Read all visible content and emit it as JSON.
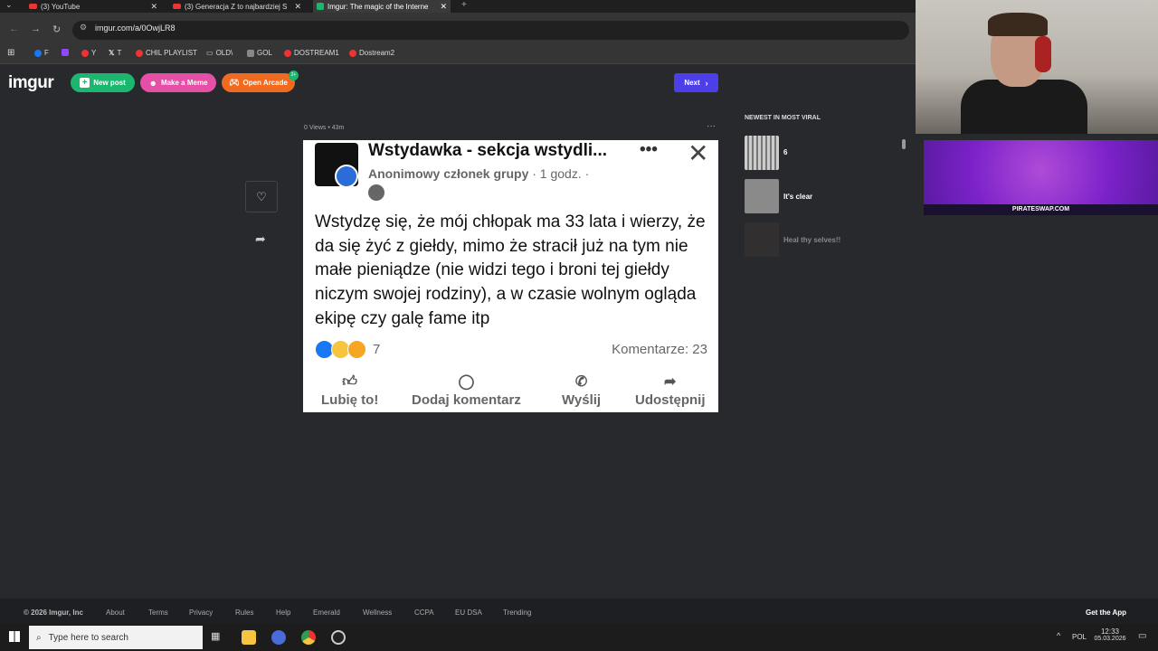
{
  "browser": {
    "tabs": [
      {
        "title": "(3) YouTube",
        "close": "✕"
      },
      {
        "title": "(3) Generacja Z to najbardziej S",
        "close": "✕"
      },
      {
        "title": "Imgur: The magic of the Interne",
        "close": "✕"
      }
    ],
    "new_tab": "+",
    "url": "imgur.com/a/0OwjLR8",
    "bookmarks": [
      "F",
      "Y",
      "T",
      "CHIL PLAYLIST",
      "OLD\\",
      "GOL",
      "DOSTREAM1",
      "Dostream2"
    ]
  },
  "header": {
    "logo": "imgur",
    "new_post": "New post",
    "make_meme": "Make a Meme",
    "open_arcade": "Open Arcade",
    "arcade_badge": "2+",
    "next": "Next"
  },
  "post": {
    "meta": "0 Views • 43m",
    "more": "···",
    "group_name": "Wstydawka - sekcja wstydli...",
    "author": "Anonimowy członek grupy",
    "time": "· 1 godz. ·",
    "text": "Wstydzę się, że mój chłopak ma 33 lata i wierzy, że da się żyć z giełdy, mimo że stracił już na tym nie małe pieniądze (nie widzi tego i broni tej giełdy niczym swojej rodziny), a w czasie wolnym ogląda ekipę czy galę fame itp",
    "reactions_count": "7",
    "comments": "Komentarze: 23",
    "actions": [
      "Lubię to!",
      "Dodaj komentarz",
      "Wyślij",
      "Udostępnij"
    ]
  },
  "sidebar": {
    "heading": "NEWEST IN MOST VIRAL",
    "items": [
      {
        "title": "6"
      },
      {
        "title": "It's clear"
      },
      {
        "title": "Heal thy selves!!"
      }
    ]
  },
  "overlay": {
    "ad_text": "PIRATESWAP.COM"
  },
  "footer": {
    "links": [
      "© 2026 Imgur, Inc",
      "About",
      "Terms",
      "Privacy",
      "Rules",
      "Help",
      "Emerald",
      "Wellness",
      "CCPA",
      "EU DSA",
      "Trending"
    ],
    "get_app": "Get the App"
  },
  "taskbar": {
    "search_placeholder": "Type here to search",
    "lang": "POL",
    "time": "12:33",
    "date": "05.03.2026"
  },
  "colors": {
    "new_post": "#1bb76e",
    "make_meme": "#e64fa6",
    "open_arcade": "#f06b1f",
    "next": "#4c3ee8",
    "page_bg": "#27292d"
  }
}
